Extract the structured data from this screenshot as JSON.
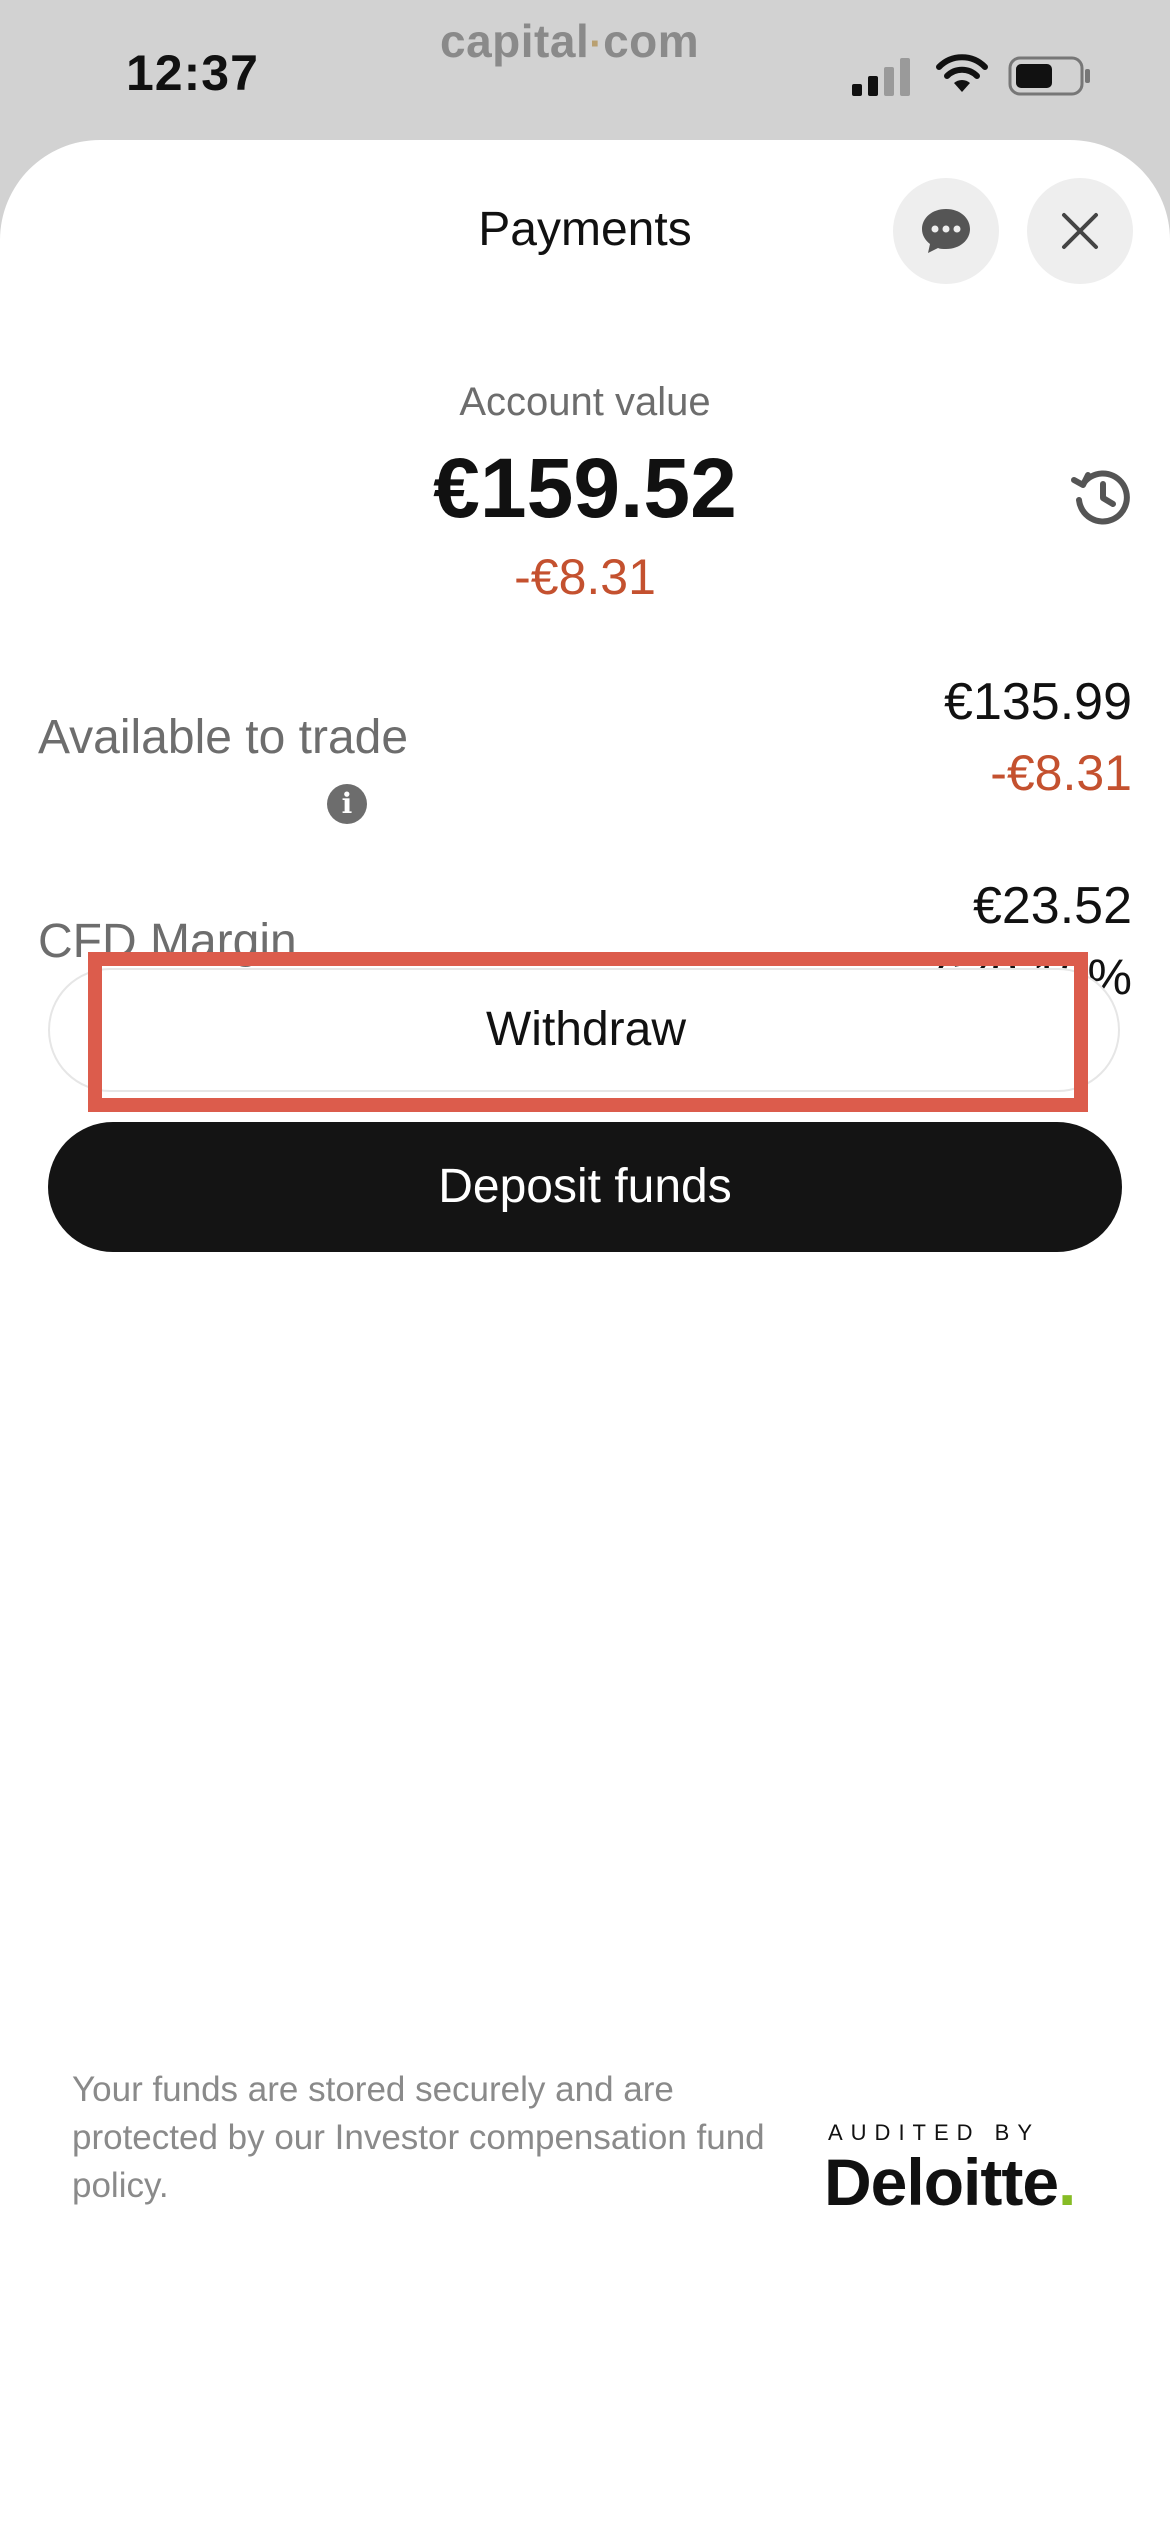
{
  "status_bar": {
    "time": "12:37",
    "brand_left": "capital",
    "brand_dot": "·",
    "brand_right": "com"
  },
  "header": {
    "title": "Payments",
    "chat_icon": "chat-bubble-icon",
    "close_icon": "close-icon"
  },
  "account": {
    "label": "Account value",
    "value": "€159.52",
    "change": "-€8.31",
    "history_icon": "history-icon"
  },
  "rows": {
    "available": {
      "label": "Available to trade",
      "value": "€135.99",
      "change": "-€8.31"
    },
    "margin": {
      "label": "CFD Margin",
      "info_icon": "i",
      "value": "€23.52",
      "percent": "678.13%"
    }
  },
  "actions": {
    "withdraw_label": "Withdraw",
    "deposit_label": "Deposit funds"
  },
  "footer": {
    "text": "Your funds are stored securely and are protected by our Investor compensation fund policy.",
    "audited_label": "AUDITED BY",
    "logo_text": "Deloitte",
    "logo_dot": "."
  },
  "colors": {
    "negative": "#c4512f",
    "highlight": "#dc5c4c",
    "primary_button": "#141414",
    "deloitte_green": "#86bc25"
  }
}
